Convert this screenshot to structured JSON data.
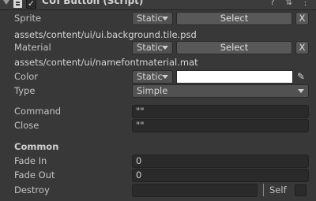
{
  "component": {
    "title": "CUI Button (Script)",
    "enabled_mark": "✓"
  },
  "header_icons": {
    "help": "?",
    "settings": "⇅",
    "menu": "⋮"
  },
  "fields": {
    "sprite": {
      "label": "Sprite",
      "mode": "Static",
      "select_label": "Select",
      "clear_label": "X",
      "path": "assets/content/ui/ui.background.tile.psd"
    },
    "material": {
      "label": "Material",
      "mode": "Static",
      "select_label": "Select",
      "clear_label": "X",
      "path": "assets/content/ui/namefontmaterial.mat"
    },
    "color": {
      "label": "Color",
      "mode": "Static",
      "value": "#ffffff"
    },
    "type": {
      "label": "Type",
      "value": "Simple"
    },
    "command": {
      "label": "Command",
      "value": "\"\""
    },
    "close": {
      "label": "Close",
      "value": "\"\""
    }
  },
  "common": {
    "heading": "Common",
    "fade_in": {
      "label": "Fade In",
      "value": "0"
    },
    "fade_out": {
      "label": "Fade Out",
      "value": "0"
    },
    "destroy": {
      "label": "Destroy",
      "value": "",
      "self_label": "Self",
      "self_checked": false
    }
  },
  "colors": {
    "panel_bg": "#383838",
    "field_bg": "#2a2a2a",
    "dropdown_bg": "#515151",
    "button_bg": "#585858"
  }
}
